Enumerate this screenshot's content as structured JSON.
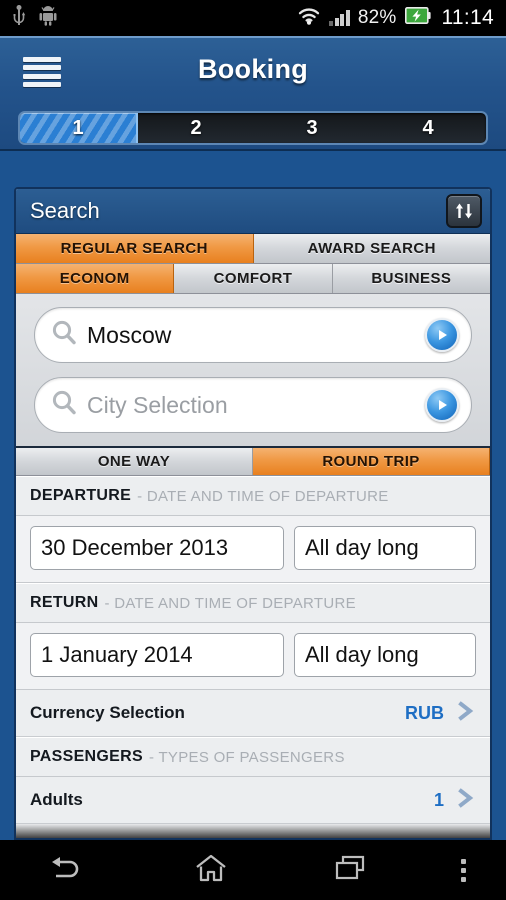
{
  "statusbar": {
    "usb_icon": "usb-icon",
    "android_icon": "android-robot-icon",
    "wifi_icon": "wifi-icon",
    "signal_icon": "signal-bars-icon",
    "battery_percent": "82%",
    "battery_icon": "battery-charging-icon",
    "time": "11:14"
  },
  "header": {
    "menu_icon": "hamburger-menu-icon",
    "title": "Booking",
    "steps": [
      {
        "label": "1",
        "active": true
      },
      {
        "label": "2",
        "active": false
      },
      {
        "label": "3",
        "active": false
      },
      {
        "label": "4",
        "active": false
      }
    ]
  },
  "search_card": {
    "title": "Search",
    "swap_icon": "swap-up-down-icon",
    "search_type_tabs": [
      {
        "label": "REGULAR SEARCH",
        "active": true
      },
      {
        "label": "AWARD SEARCH",
        "active": false
      }
    ],
    "class_tabs": [
      {
        "label": "ECONOM",
        "active": true
      },
      {
        "label": "COMFORT",
        "active": false
      },
      {
        "label": "BUSINESS",
        "active": false
      }
    ],
    "origin": {
      "value": "Moscow",
      "placeholder": "City Selection",
      "search_icon": "magnifier-icon",
      "go_icon": "play-arrow-icon"
    },
    "destination": {
      "value": "",
      "placeholder": "City Selection",
      "search_icon": "magnifier-icon",
      "go_icon": "play-arrow-icon"
    },
    "trip_tabs": [
      {
        "label": "ONE WAY",
        "active": false
      },
      {
        "label": "ROUND TRIP",
        "active": true
      }
    ],
    "departure": {
      "heading": "DEPARTURE",
      "subheading": "- DATE AND TIME OF DEPARTURE",
      "date": "30 December 2013",
      "time": "All day long"
    },
    "return": {
      "heading": "RETURN",
      "subheading": "- DATE AND TIME OF DEPARTURE",
      "date": "1 January 2014",
      "time": "All day long"
    },
    "currency_row": {
      "label": "Currency Selection",
      "value": "RUB",
      "chevron_icon": "chevron-right-icon"
    },
    "passengers": {
      "heading": "PASSENGERS",
      "subheading": "- TYPES OF PASSENGERS",
      "rows": [
        {
          "label": "Adults",
          "value": "1",
          "chevron_icon": "chevron-right-icon"
        }
      ]
    }
  },
  "navbar": {
    "back_icon": "back-arrow-icon",
    "home_icon": "home-icon",
    "recents_icon": "recent-apps-icon",
    "overflow_icon": "overflow-menu-icon"
  },
  "colors": {
    "accent_orange": "#e8801f",
    "header_blue": "#23538b",
    "page_blue": "#1c5390",
    "link_blue": "#1e6ec4"
  }
}
